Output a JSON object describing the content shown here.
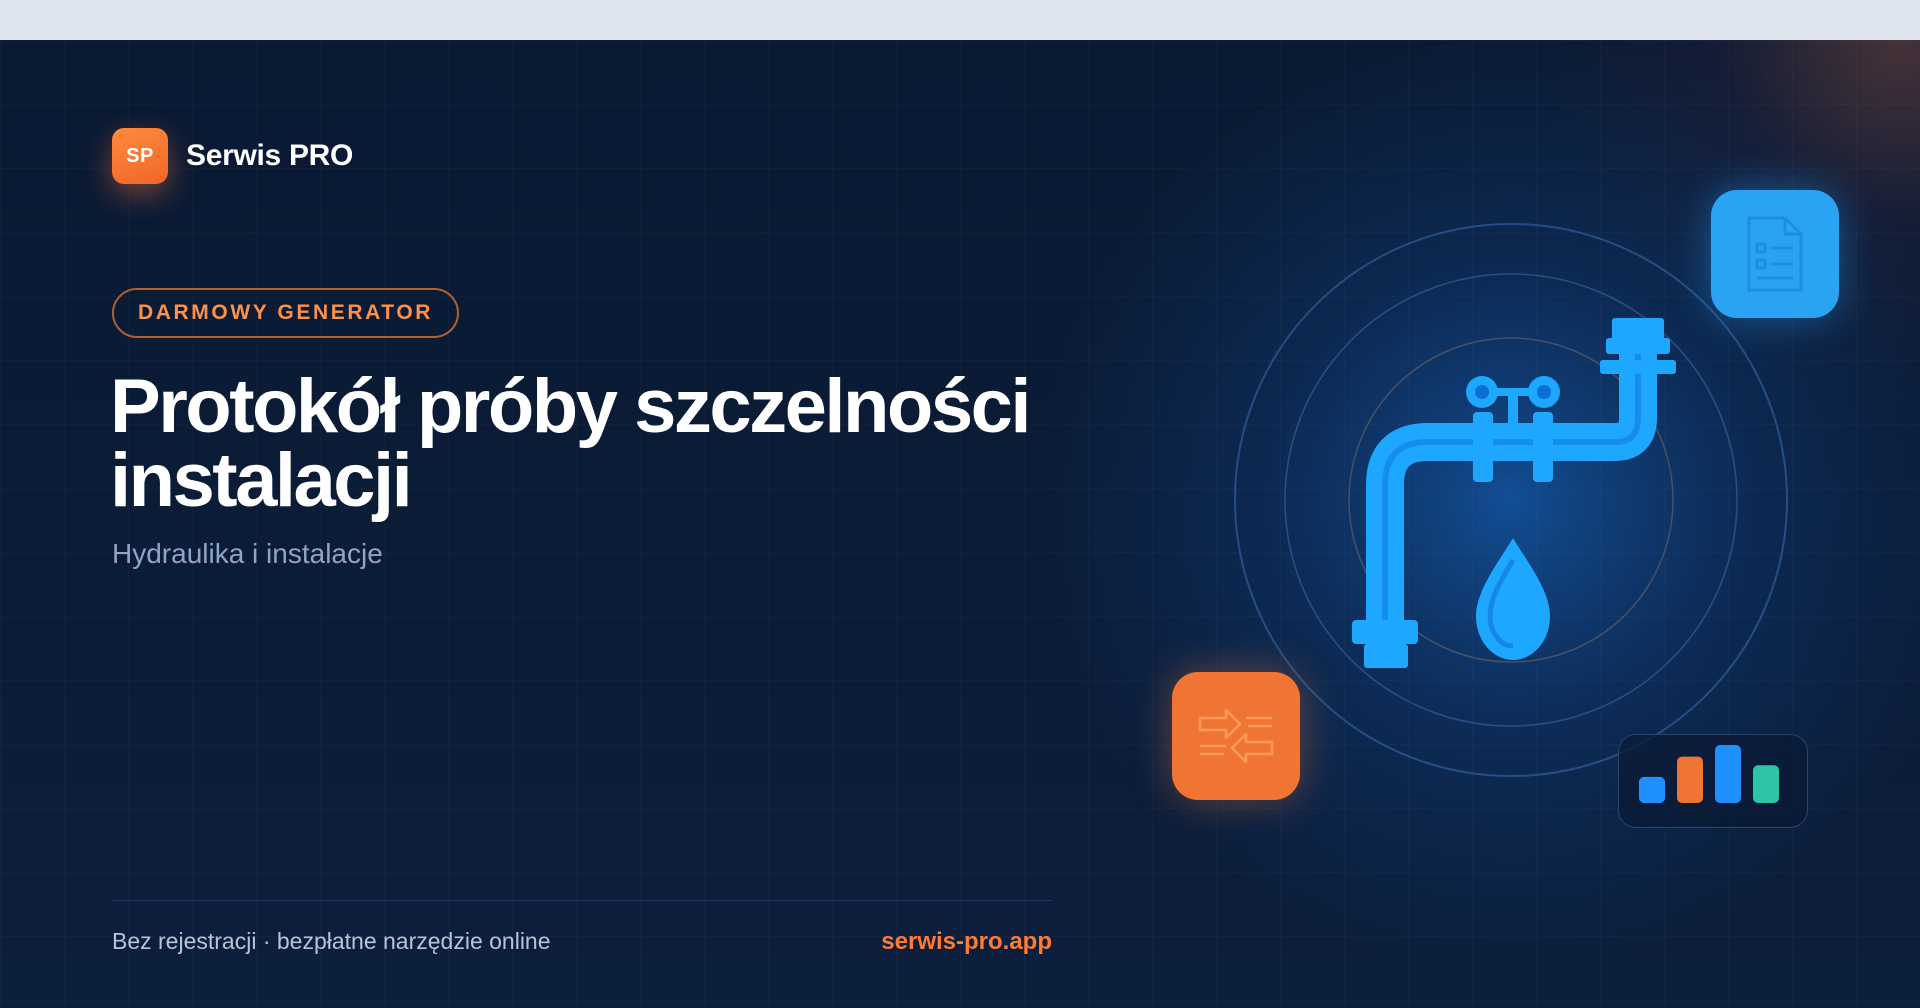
{
  "brand": {
    "logo_text": "SP",
    "name": "Serwis PRO"
  },
  "badge": {
    "label": "DARMOWY GENERATOR"
  },
  "hero": {
    "title": "Protokół próby szczelności instalacji",
    "subtitle": "Hydraulika i instalacje"
  },
  "footer": {
    "note": "Bez rejestracji · bezpłatne narzędzie online",
    "url": "serwis-pro.app"
  },
  "icons": {
    "main": "pipe-valve-water-drop-icon",
    "doc": "document-checklist-icon",
    "swap": "swap-arrows-icon",
    "chart": "bar-chart-icon"
  },
  "colors": {
    "accent": "#f07432",
    "blue": "#1ea7ff",
    "background": "#0a1a33",
    "teal": "#2ec4a6"
  },
  "mini_chart": {
    "bars": [
      {
        "value": 0.45,
        "color": "#1e90ff"
      },
      {
        "value": 0.8,
        "color": "#f07432"
      },
      {
        "value": 1.0,
        "color": "#1e90ff"
      },
      {
        "value": 0.65,
        "color": "#2ec4a6"
      }
    ]
  }
}
